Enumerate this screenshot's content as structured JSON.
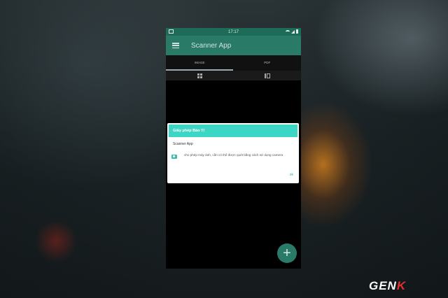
{
  "status_bar": {
    "time": "17:17"
  },
  "app_bar": {
    "title": "Scanner App",
    "menu_icon": "hamburger-menu-icon"
  },
  "tabs": [
    {
      "label": "IMAGE",
      "selected": true
    },
    {
      "label": "PDF",
      "selected": false
    }
  ],
  "view_icons": [
    "grid-view-icon",
    "list-view-icon"
  ],
  "dialog": {
    "title": "Giấy phép Báo !!!",
    "app_name": "Scanner App",
    "message": "cho phép máy ảnh, cần có thể được quét bằng cách sử dụng camera",
    "ok_label": "ok",
    "icon": "camera-icon",
    "accent_color": "#3dd6c4"
  },
  "fab": {
    "label": "+",
    "color": "#2a7a68"
  },
  "watermark": {
    "prefix": "GEN",
    "accent": "K"
  },
  "colors": {
    "status_bar": "#1e6b5a",
    "app_bar": "#2a7a68"
  }
}
